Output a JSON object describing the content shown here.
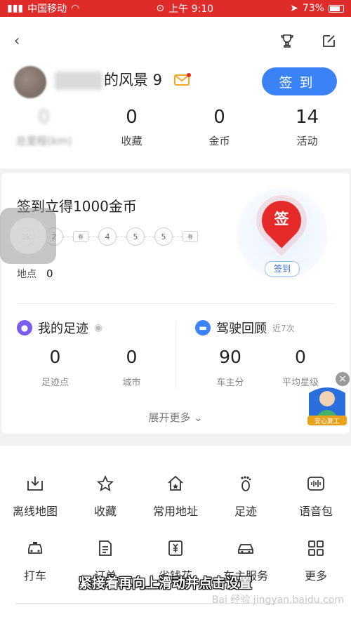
{
  "status_bar": {
    "carrier": "中国移动",
    "time": "上午 9:10",
    "battery": "73%"
  },
  "profile": {
    "name_visible": "的风景 9",
    "signin_label": "签到"
  },
  "stats": [
    {
      "num": "0",
      "label": "总里程(km)"
    },
    {
      "num": "0",
      "label": "收藏"
    },
    {
      "num": "0",
      "label": "金币"
    },
    {
      "num": "14",
      "label": "活动"
    }
  ],
  "checkin": {
    "title": "签到立得1000金币",
    "days": [
      "1k",
      "2",
      "春",
      "4",
      "5",
      "5",
      "春"
    ],
    "points_label": "地点",
    "points_value": "0",
    "badge_text": "签",
    "badge_label": "签到"
  },
  "footprint": {
    "title": "我的足迹",
    "items": [
      {
        "value": "0",
        "label": "足迹点"
      },
      {
        "value": "0",
        "label": "城市"
      }
    ]
  },
  "driving": {
    "title": "驾驶回顾",
    "subtitle": "近7次",
    "items": [
      {
        "value": "90",
        "label": "车主分"
      },
      {
        "value": "0",
        "label": "平均星级"
      }
    ]
  },
  "expand_label": "展开更多",
  "safety_badge": "安心复工",
  "grid_row1": [
    {
      "label": "离线地图",
      "icon": "offline-map-icon"
    },
    {
      "label": "收藏",
      "icon": "star-icon"
    },
    {
      "label": "常用地址",
      "icon": "home-icon"
    },
    {
      "label": "足迹",
      "icon": "footprint-icon"
    },
    {
      "label": "语音包",
      "icon": "voice-icon"
    }
  ],
  "grid_row2": [
    {
      "label": "打车",
      "icon": "taxi-icon"
    },
    {
      "label": "订单",
      "icon": "order-icon"
    },
    {
      "label": "省钱花",
      "icon": "money-icon"
    },
    {
      "label": "车主服务",
      "icon": "car-icon"
    },
    {
      "label": "更多",
      "icon": "more-grid-icon"
    }
  ],
  "caption": "紧接着再向上滑动并点击设置",
  "watermark": "Bai 经验 jingyan.baidu.com",
  "colors": {
    "accent": "#3b82f6",
    "status_bar": "#e02b2b",
    "pin": "#e62a2a"
  }
}
